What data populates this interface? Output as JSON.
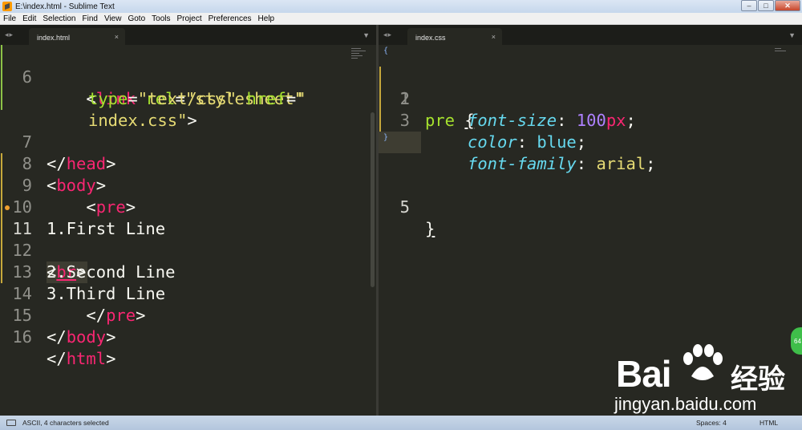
{
  "window": {
    "title": "E:\\index.html - Sublime Text",
    "buttons": {
      "minimize": "–",
      "maximize": "□",
      "close": "✕"
    }
  },
  "menu": [
    "File",
    "Edit",
    "Selection",
    "Find",
    "View",
    "Goto",
    "Tools",
    "Project",
    "Preferences",
    "Help"
  ],
  "tabs": {
    "left": {
      "label": "index.html",
      "close": "×",
      "nav": "◂▸",
      "dropdown": "▼"
    },
    "right": {
      "label": "index.css",
      "close": "×",
      "nav": "◂▸",
      "dropdown": "▼"
    }
  },
  "html_editor": {
    "line_numbers": [
      "6",
      "7",
      "8",
      "9",
      "10",
      "11",
      "12",
      "13",
      "14",
      "15",
      "16"
    ],
    "line6": {
      "indent": "    ",
      "open": "<",
      "tag": "link",
      "attr1": "rel",
      "eq1": "=",
      "val1": "\"stylesheet\"",
      "attr2": "type",
      "eq2": "=",
      "val2": "\"text/css\"",
      "attr3": "href",
      "eq3": "=",
      "val3a": "\"",
      "val3b": "index.css\"",
      "close": ">"
    },
    "line7": {
      "open": "</",
      "tag": "head",
      "close": ">"
    },
    "line8": {
      "open": "<",
      "tag": "body",
      "close": ">"
    },
    "line9": {
      "indent": "    ",
      "open": "<",
      "tag": "pre",
      "close": ">"
    },
    "line10": {
      "text": "1.First Line"
    },
    "line11": {
      "open": "<",
      "tag": "br",
      "close": ">"
    },
    "line12": {
      "text": "2.Second Line"
    },
    "line13": {
      "text": "3.Third Line"
    },
    "line14": {
      "indent": "    ",
      "open": "</",
      "tag": "pre",
      "close": ">"
    },
    "line15": {
      "open": "</",
      "tag": "body",
      "close": ">"
    },
    "line16": {
      "open": "</",
      "tag": "html",
      "close": ">"
    }
  },
  "css_editor": {
    "line_numbers": [
      "1",
      "2",
      "3",
      "4",
      "5"
    ],
    "line1": {
      "selector": "pre",
      "brace": "{"
    },
    "line2": {
      "prop": "font-size",
      "colon": ": ",
      "num": "100",
      "unit": "px",
      "semi": ";"
    },
    "line3": {
      "prop": "color",
      "colon": ": ",
      "value": "blue",
      "semi": ";"
    },
    "line4": {
      "prop": "font-family",
      "colon": ": ",
      "value": "arial",
      "semi": ";"
    },
    "line5": {
      "brace": "}"
    }
  },
  "watermark": {
    "brand": "Bai",
    "brand_cn": "经验",
    "url": "jingyan.baidu.com"
  },
  "badge": "64",
  "statusbar": {
    "left": "ASCII, 4 characters selected",
    "spaces": "Spaces: 4",
    "syntax": "HTML"
  },
  "colors": {
    "background": "#272822",
    "tag": "#f92672",
    "attribute": "#a6e22e",
    "string": "#e6db74",
    "property": "#66d9ef",
    "number": "#ae81ff"
  }
}
